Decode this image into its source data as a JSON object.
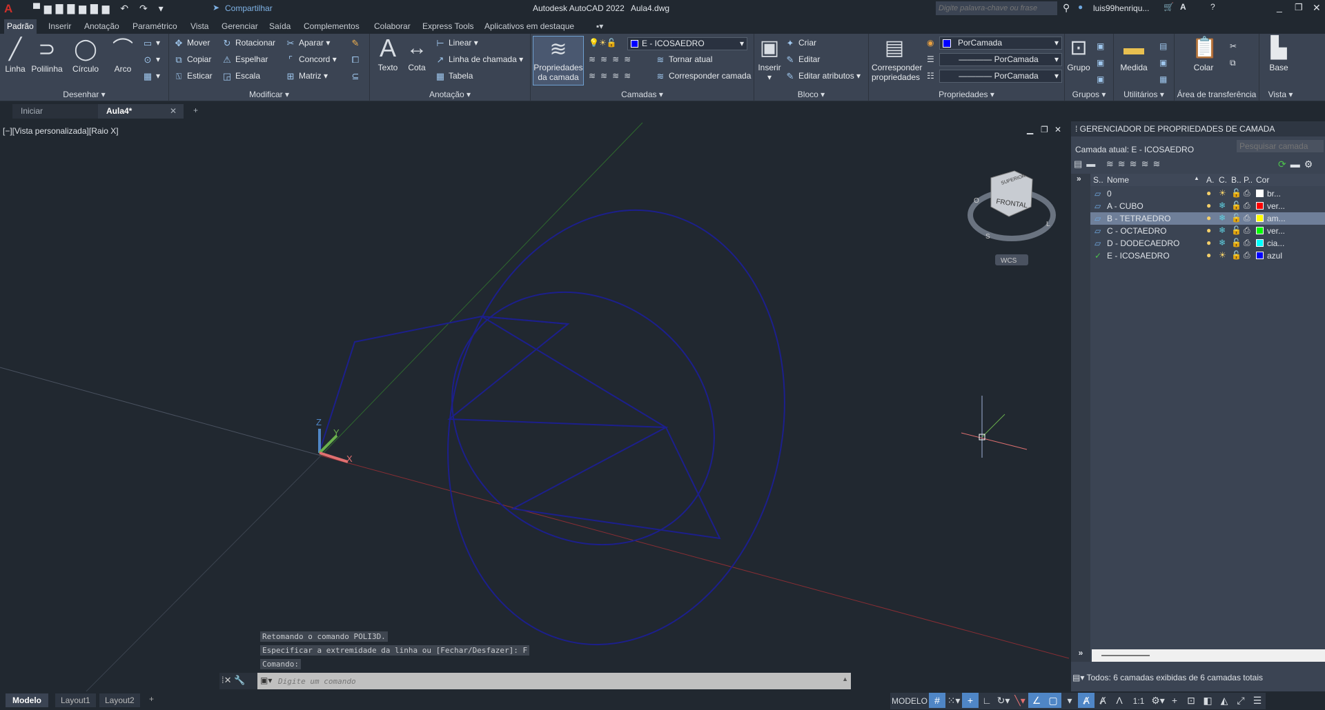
{
  "titlebar": {
    "app_title": "Autodesk AutoCAD 2022",
    "file_name": "Aula4.dwg",
    "share": "Compartilhar",
    "search_placeholder": "Digite palavra-chave ou frase",
    "user": "luis99henriqu..."
  },
  "ribbon_tabs": [
    "Padrão",
    "Inserir",
    "Anotação",
    "Paramétrico",
    "Vista",
    "Gerenciar",
    "Saída",
    "Complementos",
    "Colaborar",
    "Express Tools",
    "Aplicativos em destaque"
  ],
  "panels": {
    "desenhar": {
      "label": "Desenhar",
      "items": [
        "Linha",
        "Polilinha",
        "Círculo",
        "Arco"
      ]
    },
    "modificar": {
      "label": "Modificar",
      "items": [
        "Mover",
        "Rotacionar",
        "Aparar",
        "Copiar",
        "Espelhar",
        "Concord",
        "Esticar",
        "Escala",
        "Matriz"
      ]
    },
    "anotacao": {
      "label": "Anotação",
      "items": [
        "Texto",
        "Cota",
        "Linear",
        "Linha de chamada",
        "Tabela"
      ]
    },
    "camadas": {
      "label": "Camadas",
      "big": "Propriedades da camada",
      "current": "E - ICOSAEDRO",
      "items": [
        "Tornar atual",
        "Corresponder camada"
      ]
    },
    "bloco": {
      "label": "Bloco",
      "big": "Inserir",
      "items": [
        "Criar",
        "Editar",
        "Editar atributos"
      ]
    },
    "propriedades": {
      "label": "Propriedades",
      "big": "Corresponder propriedades",
      "color": "PorCamada",
      "linetype": "PorCamada",
      "lineweight": "PorCamada"
    },
    "grupos": {
      "label": "Grupos",
      "big": "Grupo"
    },
    "utilitarios": {
      "label": "Utilitários",
      "big": "Medida"
    },
    "area": {
      "label": "Área de transferência",
      "big": "Colar"
    },
    "vista": {
      "label": "Vista",
      "big": "Base"
    }
  },
  "file_tabs": [
    "Iniciar",
    "Aula4*"
  ],
  "viewport": {
    "label": "[−][Vista personalizada][Raio X]",
    "wcs": "WCS",
    "cube_top": "SUPERIOR",
    "cube_front": "FRONTAL",
    "compass": [
      "O",
      "S",
      "L"
    ],
    "axes": [
      "X",
      "Y",
      "Z"
    ]
  },
  "layer_manager": {
    "title": "GERENCIADOR DE PROPRIEDADES DE CAMADA",
    "current": "Camada atual: E - ICOSAEDRO",
    "search_placeholder": "Pesquisar camada",
    "columns": [
      "S..",
      "Nome",
      "A.",
      "C.",
      "B..",
      "P..",
      "Cor"
    ],
    "layers": [
      {
        "name": "0",
        "color": "#ffffff",
        "color_name": "br...",
        "frozen": false,
        "current": false,
        "selected": false
      },
      {
        "name": "A - CUBO",
        "color": "#ff0000",
        "color_name": "ver...",
        "frozen": true,
        "current": false,
        "selected": false
      },
      {
        "name": "B - TETRAEDRO",
        "color": "#ffff00",
        "color_name": "am...",
        "frozen": true,
        "current": false,
        "selected": true
      },
      {
        "name": "C - OCTAEDRO",
        "color": "#00ff00",
        "color_name": "ver...",
        "frozen": true,
        "current": false,
        "selected": false
      },
      {
        "name": "D - DODECAEDRO",
        "color": "#00ffff",
        "color_name": "cia...",
        "frozen": true,
        "current": false,
        "selected": false
      },
      {
        "name": "E - ICOSAEDRO",
        "color": "#0000ff",
        "color_name": "azul",
        "frozen": false,
        "current": true,
        "selected": false
      }
    ],
    "footer": "Todos: 6 camadas exibidas de 6 camadas totais"
  },
  "command": {
    "history": [
      "Retomando o comando POLI3D.",
      "Especificar a extremidade da linha ou [Fechar/Desfazer]: F",
      "Comando:"
    ],
    "placeholder": "Digite um comando"
  },
  "layout_tabs": [
    "Modelo",
    "Layout1",
    "Layout2"
  ],
  "status": {
    "mode": "MODELO",
    "scale": "1:1"
  }
}
